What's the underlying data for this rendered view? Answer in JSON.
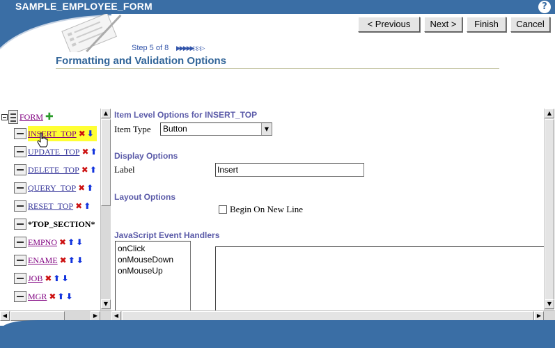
{
  "window": {
    "title": "SAMPLE_EMPLOYEE_FORM",
    "help_glyph": "?"
  },
  "nav": {
    "previous": "< Previous",
    "next": "Next >",
    "finish": "Finish",
    "cancel": "Cancel"
  },
  "wizard": {
    "step_text": "Step 5 of 8",
    "step_current": 5,
    "step_total": 8,
    "step_dots": "▶▶▶▶▶▷▷▷",
    "page_title": "Formatting and Validation Options"
  },
  "tree": {
    "root": {
      "label": "FORM",
      "add_glyph": "✚"
    },
    "items": [
      {
        "label": "INSERT_TOP",
        "selected": true
      },
      {
        "label": "UPDATE_TOP"
      },
      {
        "label": "DELETE_TOP"
      },
      {
        "label": "QUERY_TOP"
      },
      {
        "label": "RESET_TOP"
      },
      {
        "label": "*TOP_SECTION*"
      },
      {
        "label": "EMPNO"
      },
      {
        "label": "ENAME"
      },
      {
        "label": "JOB"
      },
      {
        "label": "MGR"
      }
    ],
    "delete_glyph": "✖",
    "up_glyph": "⬆",
    "down_glyph": "⬇"
  },
  "item_options": {
    "title": "Item Level Options for INSERT_TOP",
    "item_type_label": "Item Type",
    "item_type_value": "Button"
  },
  "display_options": {
    "title": "Display Options",
    "label_label": "Label",
    "label_value": "Insert"
  },
  "layout_options": {
    "title": "Layout Options",
    "begin_new_line_label": "Begin On New Line",
    "begin_new_line_checked": false
  },
  "js_handlers": {
    "title": "JavaScript Event Handlers",
    "events": [
      "onClick",
      "onMouseDown",
      "onMouseUp"
    ]
  },
  "scroll": {
    "up": "▲",
    "down": "▼",
    "left": "◀",
    "right": "▶"
  },
  "colors": {
    "brand": "#3a6ea5",
    "section_title": "#5a5aa8",
    "highlight": "#ffff33"
  }
}
